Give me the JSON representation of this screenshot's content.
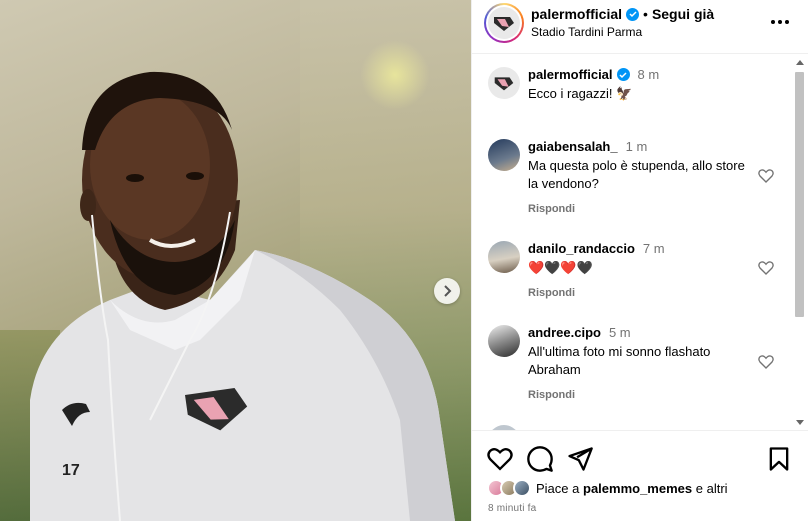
{
  "post": {
    "username": "palermofficial",
    "follow_label": "Segui già",
    "location": "Stadio Tardini Parma",
    "caption_user": "palermofficial",
    "caption_time": "8 m",
    "caption_text": "Ecco i ragazzi! 🦅",
    "jersey_number": "17"
  },
  "comments": [
    {
      "user": "gaiabensalah_",
      "time": "1 m",
      "text": "Ma questa polo è stupenda, allo store la vendono?",
      "reply": "Rispondi"
    },
    {
      "user": "danilo_randaccio",
      "time": "7 m",
      "text": "❤️🖤❤️🖤",
      "reply": "Rispondi"
    },
    {
      "user": "andree.cipo",
      "time": "5 m",
      "text": "All'ultima foto mi sonno flashato Abraham",
      "reply": "Rispondi"
    }
  ],
  "likes": {
    "prefix": "Piace a",
    "user": "palemmo_memes",
    "suffix": "e altri"
  },
  "posted_ago": "8 minuti fa",
  "icons": [
    "next-arrow-icon",
    "verified-icon",
    "more-icon",
    "heart-icon",
    "comment-icon",
    "share-icon",
    "bookmark-icon"
  ],
  "colors": {
    "verified": "#0095f6",
    "muted": "#737373",
    "divider": "#efefef"
  }
}
